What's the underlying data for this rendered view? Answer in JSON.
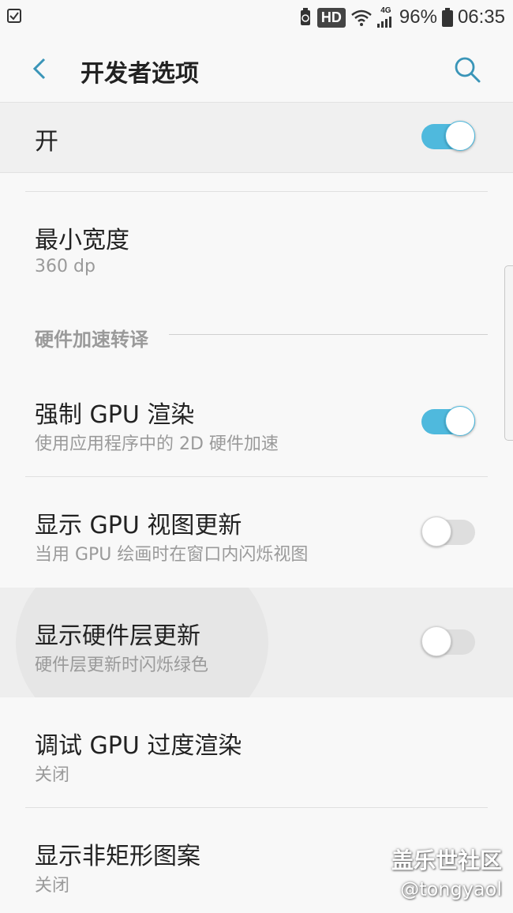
{
  "status_bar": {
    "hd": "HD",
    "network": "4G",
    "battery": "96%",
    "time": "06:35"
  },
  "app_bar": {
    "title": "开发者选项"
  },
  "master_switch": {
    "label": "开",
    "on": true
  },
  "items": [
    {
      "title": "最小宽度",
      "subtitle": "360 dp"
    },
    {
      "title": "强制 GPU 渲染",
      "subtitle": "使用应用程序中的 2D 硬件加速",
      "toggle": true
    },
    {
      "title": "显示 GPU 视图更新",
      "subtitle": "当用 GPU 绘画时在窗口内闪烁视图",
      "toggle": false
    },
    {
      "title": "显示硬件层更新",
      "subtitle": "硬件层更新时闪烁绿色",
      "toggle": false
    },
    {
      "title": "调试 GPU 过度渲染",
      "subtitle": "关闭"
    },
    {
      "title": "显示非矩形图案",
      "subtitle": "关闭"
    }
  ],
  "section": {
    "label": "硬件加速转译"
  },
  "watermark": {
    "line1": "盖乐世社区",
    "line2": "@tongyaol"
  },
  "colors": {
    "accent": "#4fb9dd",
    "background": "#f8f8f8",
    "secondary_text": "#9a9a9a"
  }
}
